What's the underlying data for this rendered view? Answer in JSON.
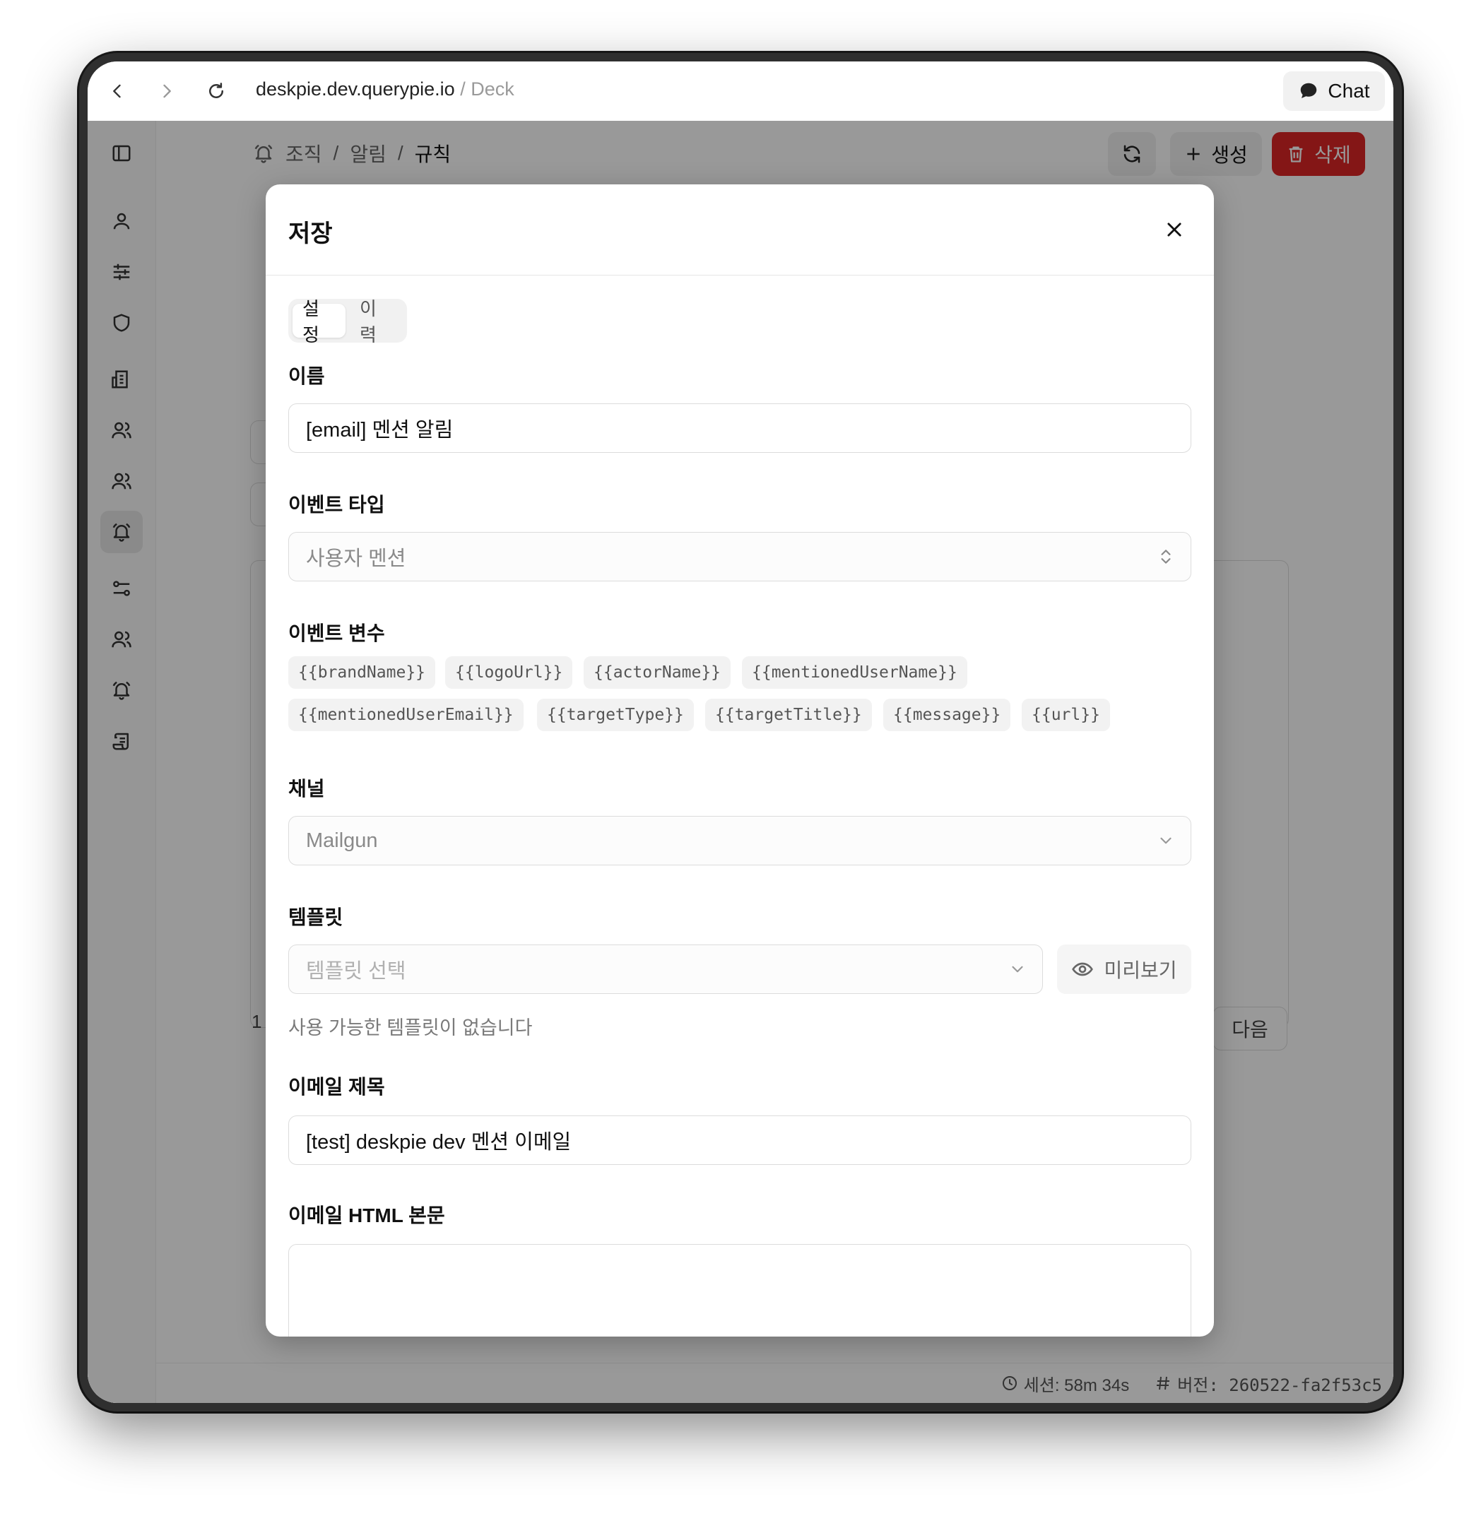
{
  "browser": {
    "url_host": "deskpie.dev.querypie.io",
    "url_sep": "/",
    "url_suffix": "Deck",
    "chat_label": "Chat"
  },
  "breadcrumb": {
    "items": [
      "조직",
      "알림",
      "규칙"
    ],
    "separator": "/"
  },
  "toolbar": {
    "create_label": "생성",
    "delete_label": "삭제"
  },
  "background": {
    "page_num": "1",
    "next_label": "다음"
  },
  "footer": {
    "session": "세션: 58m 34s",
    "version": "버전: 260522-fa2f53c5"
  },
  "modal": {
    "title": "저장",
    "tabs": [
      "설정",
      "이력"
    ],
    "name_label": "이름",
    "name_value": "[email] 멘션 알림",
    "event_type_label": "이벤트 타입",
    "event_type_value": "사용자 멘션",
    "event_vars_label": "이벤트 변수",
    "event_vars": [
      "{{brandName}}",
      "{{logoUrl}}",
      "{{actorName}}",
      "{{mentionedUserName}}",
      "{{mentionedUserEmail}}",
      "{{targetType}}",
      "{{targetTitle}}",
      "{{message}}",
      "{{url}}"
    ],
    "channel_label": "채널",
    "channel_value": "Mailgun",
    "template_label": "템플릿",
    "template_placeholder": "템플릿 선택",
    "preview_label": "미리보기",
    "template_helper": "사용 가능한 템플릿이 없습니다",
    "email_subject_label": "이메일 제목",
    "email_subject_value": "[test] deskpie dev 멘션 이메일",
    "email_html_label": "이메일 HTML 본문",
    "email_html_value": ""
  },
  "colors": {
    "danger": "#dc2626",
    "overlay": "rgba(0,0,0,0.40)"
  }
}
